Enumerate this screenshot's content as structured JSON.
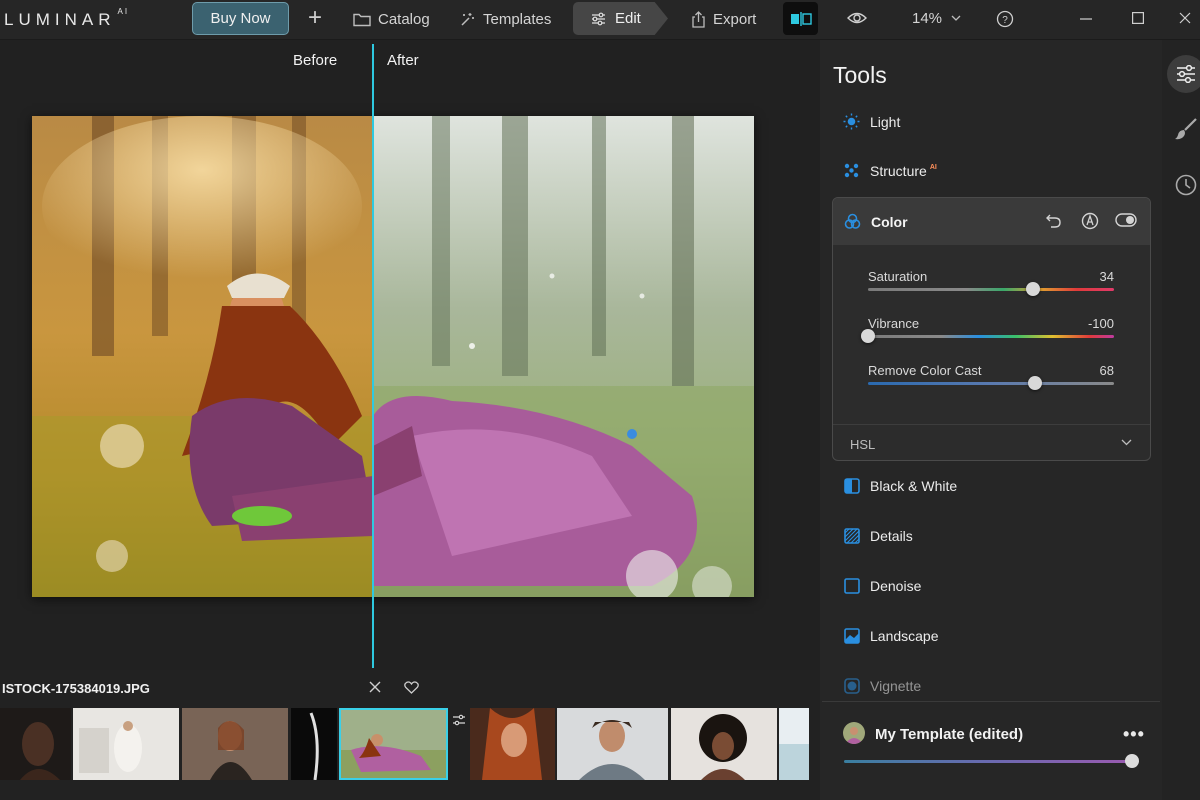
{
  "app": {
    "logo": "LUMINAR",
    "logo_sup": "AI"
  },
  "toolbar": {
    "buy_label": "Buy Now",
    "catalog_label": "Catalog",
    "templates_label": "Templates",
    "edit_label": "Edit",
    "export_label": "Export",
    "zoom_label": "14%"
  },
  "canvas": {
    "before_label": "Before",
    "after_label": "After"
  },
  "filmstrip": {
    "filename": "ISTOCK-175384019.JPG"
  },
  "tools": {
    "title": "Tools",
    "items": [
      {
        "label": "Light",
        "icon": "sun-icon"
      },
      {
        "label": "Structure",
        "badge": "AI",
        "icon": "structure-icon"
      },
      {
        "label": "Color",
        "icon": "color-icon"
      },
      {
        "label": "Black & White",
        "icon": "black-white-icon"
      },
      {
        "label": "Details",
        "icon": "details-icon"
      },
      {
        "label": "Denoise",
        "icon": "denoise-icon"
      },
      {
        "label": "Landscape",
        "icon": "landscape-icon"
      },
      {
        "label": "Vignette",
        "icon": "vignette-icon"
      }
    ],
    "color": {
      "sliders": [
        {
          "name": "Saturation",
          "value": "34",
          "fraction": 0.67
        },
        {
          "name": "Vibrance",
          "value": "-100",
          "fraction": 0.0
        },
        {
          "name": "Remove Color Cast",
          "value": "68",
          "fraction": 0.68
        }
      ],
      "hsl_label": "HSL"
    }
  },
  "template": {
    "name": "My Template (edited)",
    "more": "•••",
    "amount_fraction": 1.0
  },
  "colors": {
    "accent": "#2ec9e0",
    "tool_icon": "#2a8fe0",
    "ai_badge": "#ff8f5a"
  }
}
